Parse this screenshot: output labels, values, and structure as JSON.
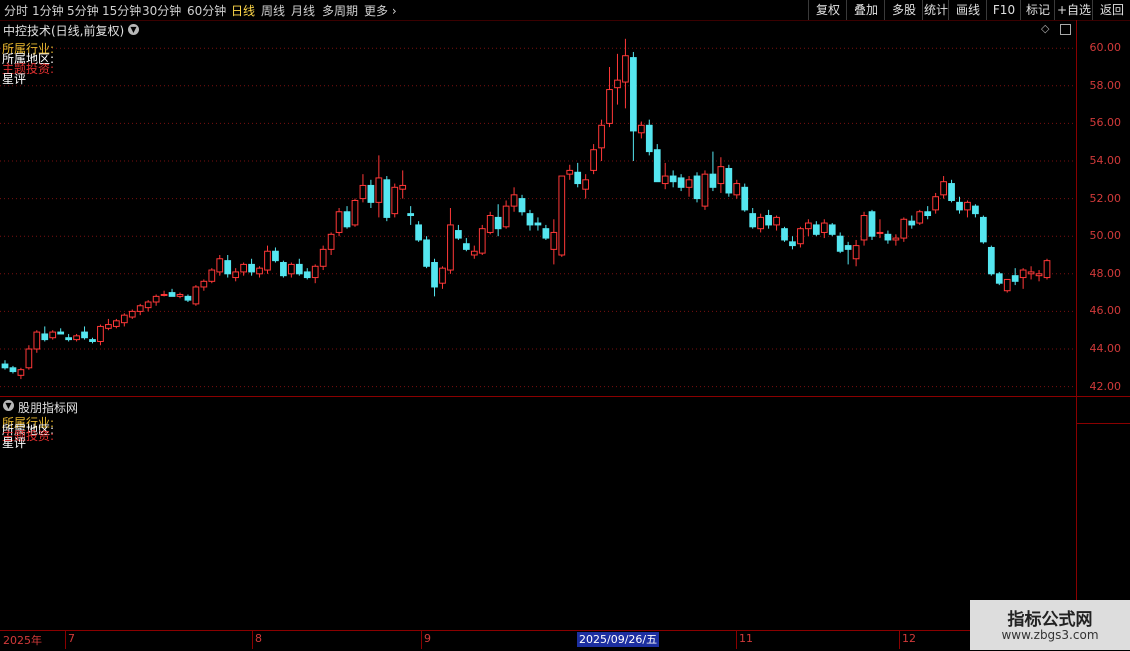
{
  "toolbar": {
    "periods": [
      "分时",
      "1分钟",
      "5分钟",
      "15分钟",
      "30分钟",
      "60分钟",
      "日线",
      "周线",
      "月线",
      "多周期",
      "更多"
    ],
    "active_period": "日线",
    "buttons": [
      "复权",
      "叠加",
      "多股",
      "统计",
      "画线",
      "F10",
      "标记",
      "+自选",
      "返回"
    ]
  },
  "main_chart": {
    "title": "中控技术(日线,前复权)",
    "info_lines": [
      {
        "text": "所属行业:",
        "color": "#e8b830"
      },
      {
        "text": "所属地区:",
        "color": "#ffffff"
      },
      {
        "text": "主题投资:",
        "color": "#e03030"
      },
      {
        "text": "星评",
        "color": "#ffffff"
      }
    ]
  },
  "lower_panel": {
    "title": "股朋指标网",
    "info_lines": [
      {
        "text": "所属行业:",
        "color": "#e8b830"
      },
      {
        "text": "所属地区:",
        "color": "#ffffff"
      },
      {
        "text": "主题投资:",
        "color": "#e03030"
      },
      {
        "text": "星评",
        "color": "#ffffff"
      }
    ]
  },
  "date_axis": {
    "labels": [
      "2025年",
      "7",
      "8",
      "9",
      "11",
      "12"
    ],
    "cursor_label": "2025/09/26/五"
  },
  "watermark": {
    "brand": "指标公式网",
    "url": "www.zbgs3.com"
  },
  "colors": {
    "up": "#ff3838",
    "down": "#55e6f0",
    "grid": "#7a1010",
    "axis_text": "#d23a3a"
  },
  "chart_data": {
    "type": "candlestick",
    "ylim": [
      41.5,
      61.5
    ],
    "y_ticks": [
      "42.00",
      "44.00",
      "46.00",
      "48.00",
      "50.00",
      "52.00",
      "54.00",
      "56.00",
      "58.00",
      "60.00"
    ],
    "ohlc": [
      [
        43.2,
        43.4,
        42.9,
        43.0
      ],
      [
        43.0,
        43.1,
        42.7,
        42.8
      ],
      [
        42.6,
        43.0,
        42.4,
        42.9
      ],
      [
        43.0,
        44.2,
        42.9,
        44.0
      ],
      [
        44.0,
        45.0,
        43.8,
        44.9
      ],
      [
        44.8,
        45.2,
        44.4,
        44.5
      ],
      [
        44.6,
        45.0,
        44.5,
        44.9
      ],
      [
        44.9,
        45.1,
        44.8,
        44.8
      ],
      [
        44.6,
        44.8,
        44.4,
        44.5
      ],
      [
        44.5,
        44.8,
        44.4,
        44.7
      ],
      [
        44.9,
        45.2,
        44.5,
        44.6
      ],
      [
        44.5,
        44.6,
        44.3,
        44.4
      ],
      [
        44.4,
        45.3,
        44.2,
        45.2
      ],
      [
        45.1,
        45.6,
        45.0,
        45.3
      ],
      [
        45.2,
        45.6,
        45.1,
        45.5
      ],
      [
        45.4,
        45.9,
        45.2,
        45.8
      ],
      [
        45.7,
        46.1,
        45.6,
        46.0
      ],
      [
        46.0,
        46.4,
        45.8,
        46.3
      ],
      [
        46.2,
        46.6,
        46.0,
        46.5
      ],
      [
        46.5,
        46.9,
        46.3,
        46.8
      ],
      [
        46.9,
        47.1,
        46.8,
        46.9
      ],
      [
        47.0,
        47.2,
        46.8,
        46.8
      ],
      [
        46.8,
        47.0,
        46.7,
        46.9
      ],
      [
        46.8,
        46.9,
        46.5,
        46.6
      ],
      [
        46.4,
        47.4,
        46.3,
        47.3
      ],
      [
        47.3,
        47.7,
        47.1,
        47.6
      ],
      [
        47.6,
        48.3,
        47.5,
        48.2
      ],
      [
        48.1,
        49.0,
        47.9,
        48.8
      ],
      [
        48.7,
        49.0,
        47.8,
        48.0
      ],
      [
        47.8,
        48.3,
        47.6,
        48.1
      ],
      [
        48.1,
        48.6,
        47.9,
        48.5
      ],
      [
        48.5,
        48.8,
        47.9,
        48.1
      ],
      [
        48.0,
        48.4,
        47.8,
        48.3
      ],
      [
        48.2,
        49.5,
        48.0,
        49.2
      ],
      [
        49.2,
        49.4,
        48.6,
        48.7
      ],
      [
        48.6,
        48.7,
        47.8,
        47.9
      ],
      [
        48.0,
        48.6,
        47.8,
        48.5
      ],
      [
        48.5,
        48.8,
        47.9,
        48.0
      ],
      [
        48.1,
        48.3,
        47.7,
        47.8
      ],
      [
        47.8,
        48.5,
        47.5,
        48.4
      ],
      [
        48.4,
        49.5,
        48.2,
        49.3
      ],
      [
        49.3,
        50.2,
        49.0,
        50.1
      ],
      [
        50.2,
        51.5,
        50.0,
        51.3
      ],
      [
        51.3,
        51.6,
        50.4,
        50.5
      ],
      [
        50.6,
        52.0,
        50.5,
        51.9
      ],
      [
        52.0,
        53.3,
        51.8,
        52.7
      ],
      [
        52.7,
        53.0,
        51.5,
        51.8
      ],
      [
        51.8,
        54.3,
        51.0,
        53.1
      ],
      [
        53.0,
        53.2,
        50.8,
        51.0
      ],
      [
        51.2,
        52.8,
        51.0,
        52.6
      ],
      [
        52.5,
        53.5,
        52.0,
        52.7
      ],
      [
        51.2,
        51.6,
        50.6,
        51.1
      ],
      [
        50.6,
        50.8,
        49.7,
        49.8
      ],
      [
        49.8,
        50.0,
        48.3,
        48.4
      ],
      [
        48.6,
        48.8,
        46.8,
        47.3
      ],
      [
        47.5,
        48.4,
        47.2,
        48.3
      ],
      [
        48.2,
        51.5,
        48.0,
        50.6
      ],
      [
        50.3,
        50.6,
        49.8,
        49.9
      ],
      [
        49.6,
        49.9,
        49.2,
        49.3
      ],
      [
        49.0,
        49.5,
        48.8,
        49.2
      ],
      [
        49.1,
        50.6,
        49.0,
        50.4
      ],
      [
        50.2,
        51.3,
        50.1,
        51.1
      ],
      [
        51.0,
        51.7,
        50.0,
        50.4
      ],
      [
        50.5,
        51.9,
        50.4,
        51.6
      ],
      [
        51.6,
        52.6,
        51.3,
        52.2
      ],
      [
        52.0,
        52.2,
        51.1,
        51.3
      ],
      [
        51.2,
        51.4,
        50.3,
        50.6
      ],
      [
        50.7,
        51.0,
        50.3,
        50.6
      ],
      [
        50.4,
        50.6,
        49.8,
        49.9
      ],
      [
        49.3,
        50.9,
        48.5,
        50.2
      ],
      [
        49.0,
        53.2,
        48.9,
        53.2
      ],
      [
        53.3,
        53.8,
        53.0,
        53.5
      ],
      [
        53.4,
        53.9,
        52.6,
        52.8
      ],
      [
        52.5,
        53.3,
        52.0,
        53.0
      ],
      [
        53.5,
        54.9,
        53.3,
        54.6
      ],
      [
        54.7,
        56.2,
        54.0,
        55.9
      ],
      [
        56.0,
        59.0,
        55.8,
        57.8
      ],
      [
        57.9,
        59.7,
        57.0,
        58.3
      ],
      [
        58.2,
        60.5,
        56.8,
        59.6
      ],
      [
        59.5,
        59.8,
        54.0,
        55.6
      ],
      [
        55.5,
        56.1,
        55.2,
        55.9
      ],
      [
        55.9,
        56.2,
        54.3,
        54.5
      ],
      [
        54.6,
        54.9,
        52.9,
        52.9
      ],
      [
        52.8,
        53.9,
        52.5,
        53.2
      ],
      [
        53.2,
        53.5,
        52.6,
        52.9
      ],
      [
        53.1,
        53.3,
        52.4,
        52.6
      ],
      [
        52.6,
        53.2,
        52.1,
        53.0
      ],
      [
        53.2,
        53.4,
        51.8,
        52.0
      ],
      [
        51.6,
        53.5,
        51.4,
        53.3
      ],
      [
        53.3,
        54.5,
        52.4,
        52.6
      ],
      [
        52.8,
        54.2,
        52.3,
        53.7
      ],
      [
        53.6,
        53.8,
        52.1,
        52.3
      ],
      [
        52.2,
        53.0,
        52.0,
        52.8
      ],
      [
        52.6,
        52.8,
        51.3,
        51.4
      ],
      [
        51.2,
        51.5,
        50.4,
        50.5
      ],
      [
        50.4,
        51.2,
        50.2,
        51.0
      ],
      [
        51.1,
        51.4,
        50.4,
        50.6
      ],
      [
        50.6,
        51.1,
        50.3,
        51.0
      ],
      [
        50.4,
        50.5,
        49.7,
        49.8
      ],
      [
        49.7,
        50.0,
        49.3,
        49.5
      ],
      [
        49.6,
        50.5,
        49.4,
        50.4
      ],
      [
        50.4,
        50.9,
        50.0,
        50.7
      ],
      [
        50.6,
        50.8,
        50.0,
        50.1
      ],
      [
        50.2,
        50.9,
        49.9,
        50.7
      ],
      [
        50.6,
        50.7,
        50.0,
        50.1
      ],
      [
        50.0,
        50.2,
        49.1,
        49.2
      ],
      [
        49.5,
        49.7,
        48.5,
        49.3
      ],
      [
        48.8,
        49.8,
        48.4,
        49.5
      ],
      [
        49.8,
        51.3,
        49.5,
        51.1
      ],
      [
        51.3,
        51.4,
        49.8,
        50.0
      ],
      [
        50.2,
        50.9,
        49.9,
        50.2
      ],
      [
        50.1,
        50.3,
        49.6,
        49.8
      ],
      [
        49.8,
        50.1,
        49.5,
        49.9
      ],
      [
        49.9,
        51.0,
        49.7,
        50.9
      ],
      [
        50.8,
        51.1,
        50.4,
        50.6
      ],
      [
        50.7,
        51.4,
        50.6,
        51.3
      ],
      [
        51.3,
        51.6,
        50.9,
        51.1
      ],
      [
        51.4,
        52.3,
        51.2,
        52.1
      ],
      [
        52.2,
        53.2,
        52.0,
        52.9
      ],
      [
        52.8,
        53.0,
        51.8,
        51.9
      ],
      [
        51.8,
        52.1,
        51.2,
        51.4
      ],
      [
        51.4,
        51.9,
        51.0,
        51.8
      ],
      [
        51.6,
        51.7,
        51.0,
        51.2
      ],
      [
        51.0,
        51.1,
        49.6,
        49.7
      ],
      [
        49.4,
        49.5,
        47.9,
        48.0
      ],
      [
        48.0,
        48.1,
        47.4,
        47.5
      ],
      [
        47.1,
        47.7,
        47.0,
        47.7
      ],
      [
        47.9,
        48.3,
        47.4,
        47.6
      ],
      [
        47.8,
        48.3,
        47.2,
        48.2
      ],
      [
        48.0,
        48.4,
        47.7,
        48.1
      ],
      [
        47.9,
        48.2,
        47.6,
        48.0
      ],
      [
        47.8,
        48.8,
        47.7,
        48.7
      ]
    ]
  }
}
